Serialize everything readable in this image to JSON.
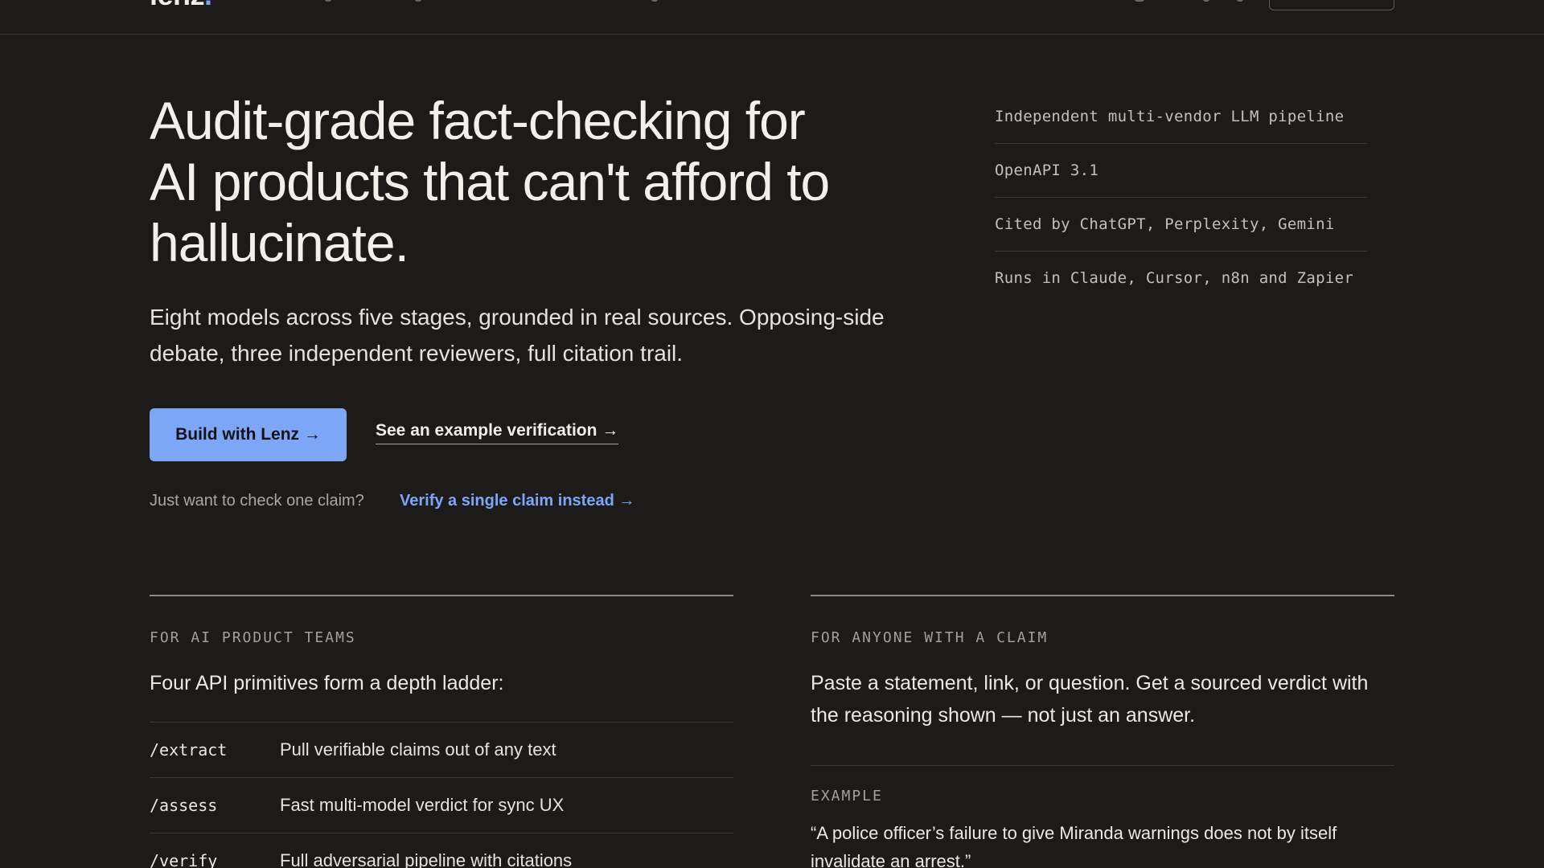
{
  "nav": {
    "logo_text": "lenz",
    "logo_dot": "."
  },
  "hero": {
    "title": "Audit-grade fact-checking for AI products that can't afford to hallucinate.",
    "subtitle": "Eight models across five stages, grounded in real sources. Opposing-side debate, three independent reviewers, full citation trail.",
    "primary_cta": "Build with Lenz →",
    "secondary_cta": "See an example verification →",
    "claim_question": "Just want to check one claim?",
    "claim_link": "Verify a single claim instead →"
  },
  "meta": {
    "items": [
      "Independent multi-vendor LLM pipeline",
      "OpenAPI 3.1",
      "Cited by ChatGPT, Perplexity, Gemini",
      "Runs in Claude, Cursor, n8n and Zapier"
    ]
  },
  "teams": {
    "eyebrow": "FOR AI PRODUCT TEAMS",
    "lead": "Four API primitives form a depth ladder:",
    "rows": [
      {
        "endpoint": "/extract",
        "description": "Pull verifiable claims out of any text"
      },
      {
        "endpoint": "/assess",
        "description": "Fast multi-model verdict for sync UX"
      },
      {
        "endpoint": "/verify",
        "description": "Full adversarial pipeline with citations"
      }
    ]
  },
  "claim": {
    "eyebrow": "FOR ANYONE WITH A CLAIM",
    "lead": "Paste a statement, link, or question. Get a sourced verdict with the reasoning shown — not just an answer.",
    "example_label": "EXAMPLE",
    "example_quote": "“A police officer’s failure to give Miranda warnings does not by itself invalidate an arrest.”"
  },
  "colors": {
    "background": "#1c1b1a",
    "accent": "#7ea6f6",
    "text": "#ece9e4"
  }
}
